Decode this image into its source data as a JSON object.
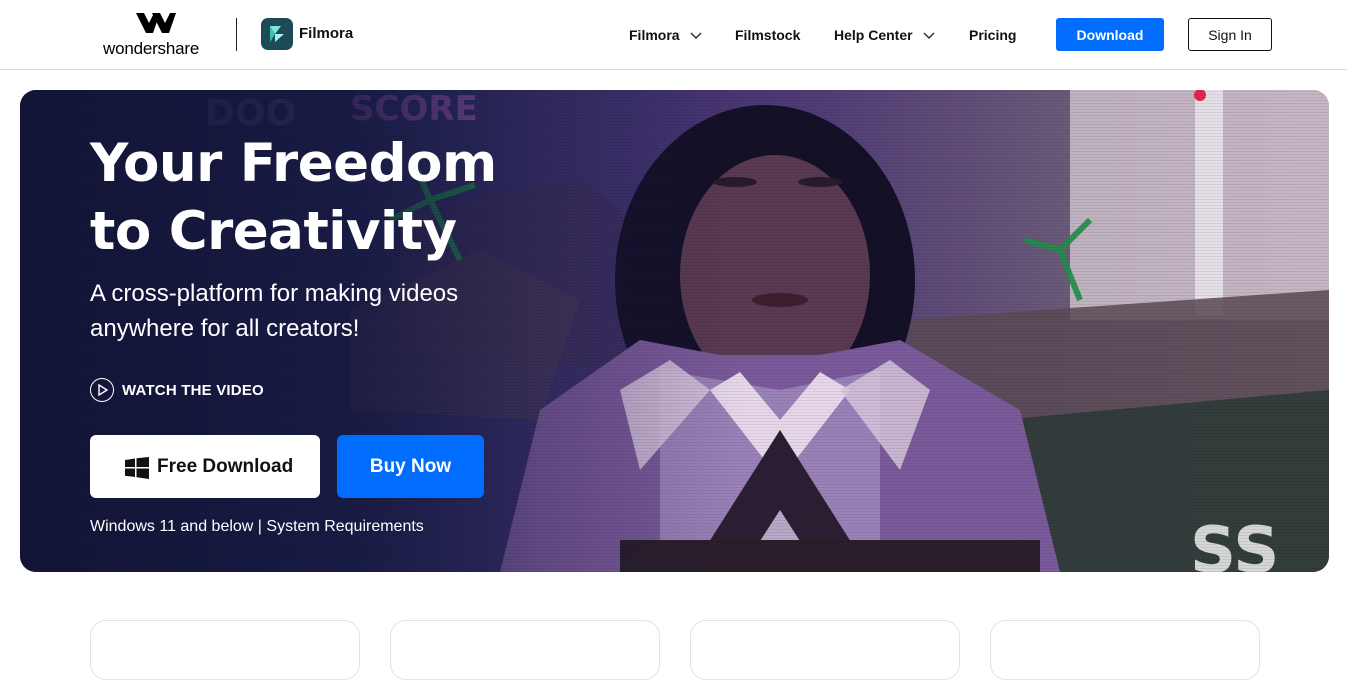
{
  "header": {
    "brand_word": "wondershare",
    "product_name": "Filmora",
    "nav": [
      {
        "label": "Filmora",
        "has_dropdown": true
      },
      {
        "label": "Filmstock",
        "has_dropdown": false
      },
      {
        "label": "Help Center",
        "has_dropdown": true
      },
      {
        "label": "Pricing",
        "has_dropdown": false
      }
    ],
    "download_label": "Download",
    "signin_label": "Sign In"
  },
  "hero": {
    "title_line1": "Your Freedom",
    "title_line2": "to Creativity",
    "subtitle_line1": "A cross-platform for making videos",
    "subtitle_line2": "anywhere for all creators!",
    "watch_label": "WATCH THE VIDEO",
    "free_download_label": "Free Download",
    "buy_label": "Buy Now",
    "os_note": "Windows 11 and below",
    "separator": " | ",
    "sysreq_link": "System Requirements"
  },
  "colors": {
    "accent": "#006dff",
    "hero_bg": "#252a5c",
    "filmora_icon": "#1e4a57"
  },
  "icons": [
    "wondershare-logo-icon",
    "filmora-logo-icon",
    "chevron-down-icon",
    "play-circle-icon",
    "windows-icon"
  ]
}
